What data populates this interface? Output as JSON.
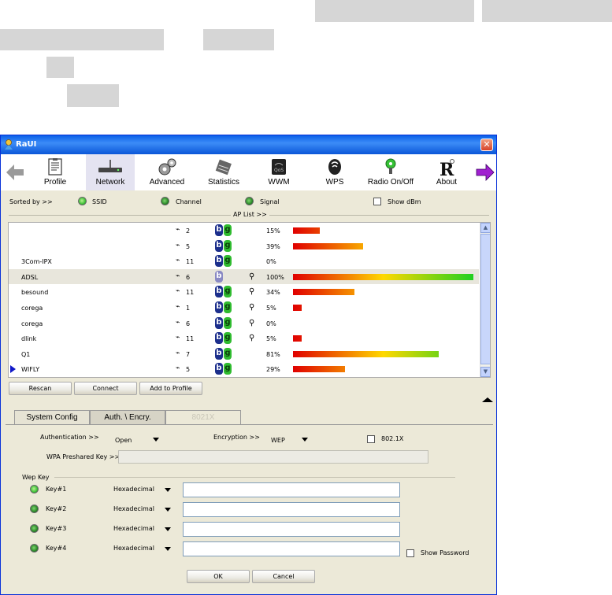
{
  "window": {
    "title": "RaUI",
    "close_glyph": "✕"
  },
  "toolbar": {
    "items": [
      {
        "label": "Profile",
        "icon": "profile-icon"
      },
      {
        "label": "Network",
        "icon": "network-icon"
      },
      {
        "label": "Advanced",
        "icon": "advanced-gear-icon"
      },
      {
        "label": "Statistics",
        "icon": "statistics-icon"
      },
      {
        "label": "WWM",
        "icon": "wwm-qos-icon"
      },
      {
        "label": "WPS",
        "icon": "wps-icon"
      },
      {
        "label": "Radio On/Off",
        "icon": "radio-icon"
      },
      {
        "label": "About",
        "icon": "about-icon"
      }
    ],
    "selected": "Network",
    "accent": "#e4e3f1"
  },
  "sort": {
    "prefix": "Sorted by >>",
    "ssid": "SSID",
    "channel": "Channel",
    "signal": "Signal",
    "show_dbm": "Show dBm"
  },
  "ap_list": {
    "caption": "AP List >>",
    "rows": [
      {
        "ssid": "",
        "channel": "2",
        "g": true,
        "locked": false,
        "signal": "15%",
        "level": 0.15
      },
      {
        "ssid": "",
        "channel": "5",
        "g": true,
        "locked": false,
        "signal": "39%",
        "level": 0.39
      },
      {
        "ssid": "3Com-IPX",
        "channel": "11",
        "g": true,
        "locked": false,
        "signal": "0%",
        "level": 0
      },
      {
        "ssid": "ADSL",
        "channel": "6",
        "g": false,
        "locked": true,
        "signal": "100%",
        "level": 1.0
      },
      {
        "ssid": "besound",
        "channel": "11",
        "g": true,
        "locked": true,
        "signal": "34%",
        "level": 0.34
      },
      {
        "ssid": "corega",
        "channel": "1",
        "g": true,
        "locked": true,
        "signal": "5%",
        "level": 0.05
      },
      {
        "ssid": "corega",
        "channel": "6",
        "g": true,
        "locked": true,
        "signal": "0%",
        "level": 0
      },
      {
        "ssid": "dlink",
        "channel": "11",
        "g": true,
        "locked": true,
        "signal": "5%",
        "level": 0.05
      },
      {
        "ssid": "Q1",
        "channel": "7",
        "g": true,
        "locked": false,
        "signal": "81%",
        "level": 0.81
      },
      {
        "ssid": "WIFLY",
        "channel": "5",
        "g": true,
        "locked": false,
        "signal": "29%",
        "level": 0.29
      }
    ],
    "selected_row": "ADSL",
    "connected_row": "WIFLY"
  },
  "buttons": {
    "rescan": "Rescan",
    "connect": "Connect",
    "add_profile": "Add to Profile",
    "ok": "OK",
    "cancel": "Cancel"
  },
  "tabs": {
    "system_config": "System Config",
    "auth": "Auth. \\ Encry.",
    "dot1x": "8021X"
  },
  "auth": {
    "authentication_label": "Authentication >>",
    "authentication_value": "Open",
    "encryption_label": "Encryption >>",
    "encryption_value": "WEP",
    "dot1x_label": "802.1X",
    "wpa_label": "WPA Preshared Key >>",
    "wpa_value": ""
  },
  "wep": {
    "group_label": "Wep Key",
    "keys": [
      {
        "label": "Key#1",
        "format": "Hexadecimal",
        "value": ""
      },
      {
        "label": "Key#2",
        "format": "Hexadecimal",
        "value": ""
      },
      {
        "label": "Key#3",
        "format": "Hexadecimal",
        "value": ""
      },
      {
        "label": "Key#4",
        "format": "Hexadecimal",
        "value": ""
      }
    ],
    "show_password": "Show Password"
  },
  "colors": {
    "window_bg": "#ece9d8",
    "titlebar": "#0a5fe8",
    "b_badge": "#1c2f8c",
    "g_badge": "#2fbb2f"
  }
}
